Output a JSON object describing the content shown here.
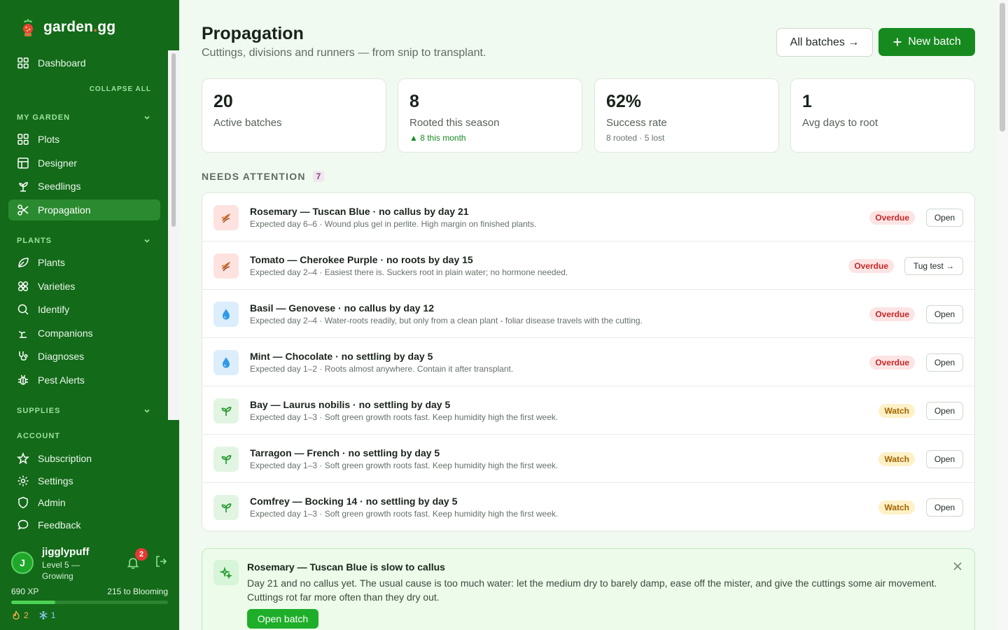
{
  "brand": {
    "name_prefix": "garden",
    "name_dot": ".",
    "name_suffix": "gg"
  },
  "sidebar": {
    "dashboard": "Dashboard",
    "collapse_all": "COLLAPSE ALL",
    "sections": {
      "my_garden": "MY GARDEN",
      "plants": "PLANTS",
      "supplies": "SUPPLIES",
      "account": "ACCOUNT"
    },
    "my_garden_items": [
      {
        "label": "Plots",
        "icon": "grid-icon"
      },
      {
        "label": "Designer",
        "icon": "layout-icon"
      },
      {
        "label": "Seedlings",
        "icon": "sprout-icon"
      },
      {
        "label": "Propagation",
        "icon": "scissors-icon",
        "active": true
      }
    ],
    "plants_items": [
      {
        "label": "Plants",
        "icon": "leaf-icon"
      },
      {
        "label": "Varieties",
        "icon": "flower-icon"
      },
      {
        "label": "Identify",
        "icon": "search-icon"
      },
      {
        "label": "Companions",
        "icon": "companion-icon"
      },
      {
        "label": "Diagnoses",
        "icon": "stethoscope-icon"
      },
      {
        "label": "Pest Alerts",
        "icon": "bug-icon"
      }
    ],
    "account_items": [
      {
        "label": "Subscription",
        "icon": "star-icon"
      },
      {
        "label": "Settings",
        "icon": "gear-icon"
      },
      {
        "label": "Admin",
        "icon": "shield-icon"
      },
      {
        "label": "Feedback",
        "icon": "chat-icon"
      }
    ]
  },
  "user": {
    "initial": "J",
    "name": "jigglypuff",
    "level": "Level 5 — Growing",
    "notifications": "2",
    "xp": "690 XP",
    "to_next": "215 to Blooming",
    "xp_progress_fraction": 0.28,
    "streak_fire": "2",
    "streak_frost": "1"
  },
  "page": {
    "title": "Propagation",
    "subtitle": "Cuttings, divisions and runners — from snip to transplant.",
    "all_batches": "All batches →",
    "new_batch": "New batch"
  },
  "stats": [
    {
      "value": "20",
      "label": "Active batches",
      "note": ""
    },
    {
      "value": "8",
      "label": "Rooted this season",
      "note": "▲ 8 this month"
    },
    {
      "value": "62%",
      "label": "Success rate",
      "note": "8 rooted · 5 lost"
    },
    {
      "value": "1",
      "label": "Avg days to root",
      "note": ""
    }
  ],
  "attention": {
    "heading": "NEEDS ATTENTION",
    "count": "7",
    "rows": [
      {
        "icon": "cutting-icon",
        "tone": "red",
        "title": "Rosemary — Tuscan Blue · no callus by day 21",
        "sub": "Expected day 6–6 · Wound plus gel in perlite. High margin on finished plants.",
        "status": "Overdue",
        "action": "Open"
      },
      {
        "icon": "cutting-icon",
        "tone": "red",
        "title": "Tomato — Cherokee Purple · no roots by day 15",
        "sub": "Expected day 2–4 · Easiest there is. Suckers root in plain water; no hormone needed.",
        "status": "Overdue",
        "action": "Tug test →"
      },
      {
        "icon": "water-drop-icon",
        "tone": "blue",
        "title": "Basil — Genovese · no callus by day 12",
        "sub": "Expected day 2–4 · Water-roots readily, but only from a clean plant - foliar disease travels with the cutting.",
        "status": "Overdue",
        "action": "Open"
      },
      {
        "icon": "water-drop-icon",
        "tone": "blue",
        "title": "Mint — Chocolate · no settling by day 5",
        "sub": "Expected day 1–2 · Roots almost anywhere. Contain it after transplant.",
        "status": "Overdue",
        "action": "Open"
      },
      {
        "icon": "sprout-icon",
        "tone": "green",
        "title": "Bay — Laurus nobilis · no settling by day 5",
        "sub": "Expected day 1–3 · Soft green growth roots fast. Keep humidity high the first week.",
        "status": "Watch",
        "action": "Open"
      },
      {
        "icon": "sprout-icon",
        "tone": "green",
        "title": "Tarragon — French · no settling by day 5",
        "sub": "Expected day 1–3 · Soft green growth roots fast. Keep humidity high the first week.",
        "status": "Watch",
        "action": "Open"
      },
      {
        "icon": "sprout-icon",
        "tone": "green",
        "title": "Comfrey — Bocking 14 · no settling by day 5",
        "sub": "Expected day 1–3 · Soft green growth roots fast. Keep humidity high the first week.",
        "status": "Watch",
        "action": "Open"
      }
    ]
  },
  "tip": {
    "title": "Rosemary — Tuscan Blue is slow to callus",
    "body": "Day 21 and no callus yet. The usual cause is too much water: let the medium dry to barely damp, ease off the mister, and give the cuttings some air movement. Cuttings rot far more often than they dry out.",
    "action": "Open batch"
  },
  "colors": {
    "sidebar": "#136a19",
    "accent": "#168a1f",
    "overdue": "#c62828",
    "watch": "#a06400"
  }
}
